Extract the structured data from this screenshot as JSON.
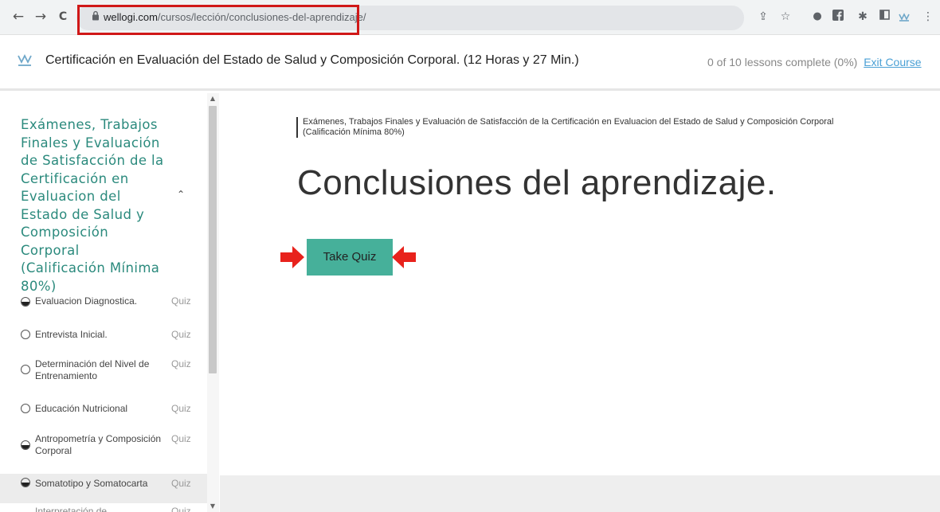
{
  "browser": {
    "url_host": "wellogi.com",
    "url_path": "/cursos/lección/conclusiones-del-aprendizaje/",
    "nav": {
      "back": "←",
      "forward": "→",
      "reload": "C"
    }
  },
  "course": {
    "title": "Certificación en Evaluación del Estado de Salud y Composición Corporal. (12 Horas y 27 Min.)",
    "progress": "0 of 10 lessons complete (0%)",
    "exit_label": "Exit Course"
  },
  "sidebar": {
    "section_title": "Exámenes, Trabajos Finales y Evaluación de Satisfacción de la Certificación en Evaluacion del Estado de Salud y Composición Corporal (Calificación Mínima 80%)",
    "lessons": [
      {
        "name": "Evaluacion Diagnostica.",
        "type": "Quiz",
        "status": "half"
      },
      {
        "name": "Entrevista Inicial.",
        "type": "Quiz",
        "status": "empty"
      },
      {
        "name": "Determinación del Nivel de Entrenamiento",
        "type": "Quiz",
        "status": "empty"
      },
      {
        "name": "Educación Nutricional",
        "type": "Quiz",
        "status": "empty"
      },
      {
        "name": "Antropometría y Composición Corporal",
        "type": "Quiz",
        "status": "half"
      },
      {
        "name": "Somatotipo y Somatocarta",
        "type": "Quiz",
        "status": "half"
      },
      {
        "name": "Interpretación de",
        "type": "Quiz",
        "status": "empty"
      }
    ]
  },
  "main": {
    "breadcrumb": "Exámenes, Trabajos Finales y Evaluación de Satisfacción de la Certificación en Evaluacion del Estado de Salud y Composición Corporal (Calificación Mínima 80%)",
    "lesson_title": "Conclusiones del aprendizaje.",
    "quiz_button": "Take Quiz"
  },
  "colors": {
    "accent": "#46b09a",
    "section_title": "#2b8a7d",
    "highlight_box": "#d01818",
    "arrow": "#e8221c",
    "link": "#4aa0d5"
  }
}
